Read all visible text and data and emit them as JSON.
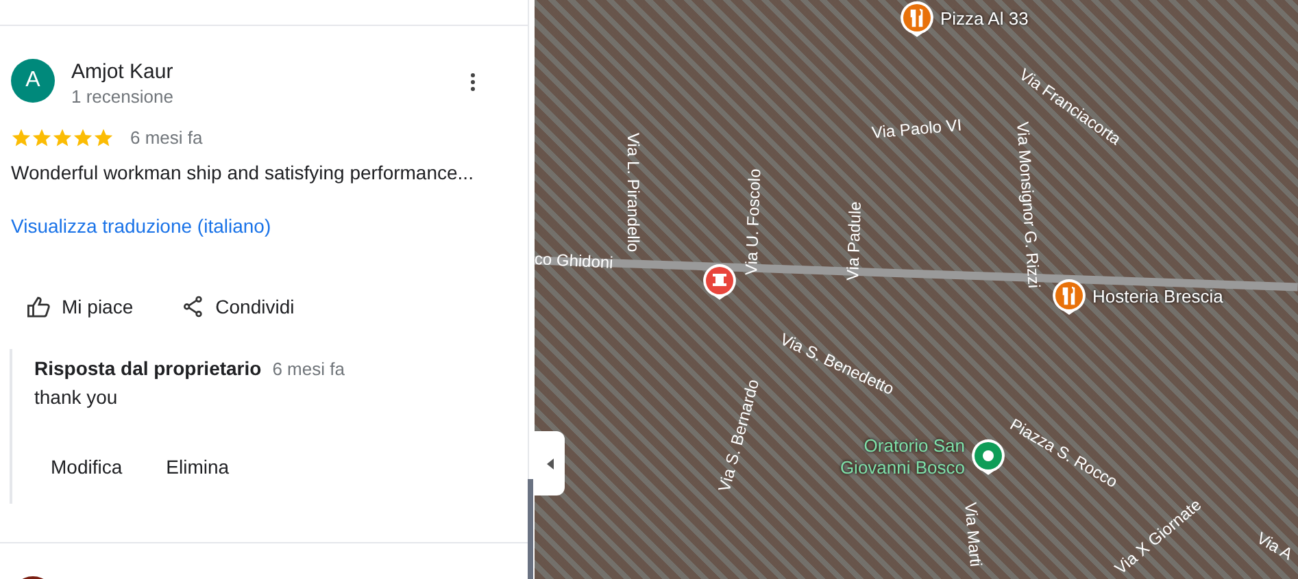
{
  "review": {
    "avatar_letter": "A",
    "author": "Amjot Kaur",
    "count": "1 recensione",
    "stars": 5,
    "time": "6 mesi fa",
    "text": "Wonderful workman ship and satisfying performance...",
    "translate_link": "Visualizza traduzione (italiano)",
    "actions": [
      {
        "kind": "like",
        "label": "Mi piace"
      },
      {
        "kind": "share",
        "label": "Condividi"
      }
    ],
    "reply": {
      "title": "Risposta dal proprietario",
      "time": "6 mesi fa",
      "text": "thank you",
      "buttons": [
        "Modifica",
        "Elimina"
      ]
    }
  },
  "map": {
    "places": [
      {
        "kind": "restaurant",
        "name": "Pizza Al 33"
      },
      {
        "kind": "restaurant",
        "name": "Hosteria Brescia"
      },
      {
        "kind": "pharmacy"
      },
      {
        "kind": "park",
        "name": "Oratorio San Giovanni Bosco"
      }
    ],
    "streets": [
      "Via Franciacorta",
      "Via Paolo VI",
      "Via L. Pirandello",
      "Via U. Foscolo",
      "Via Padule",
      "Via Monsignor G. Rizzi",
      "co Ghidoni",
      "Via S. Benedetto",
      "Via S. Bernardo",
      "Piazza S. Rocco",
      "Via X Giornate",
      "Via Marti",
      "Via A"
    ]
  }
}
